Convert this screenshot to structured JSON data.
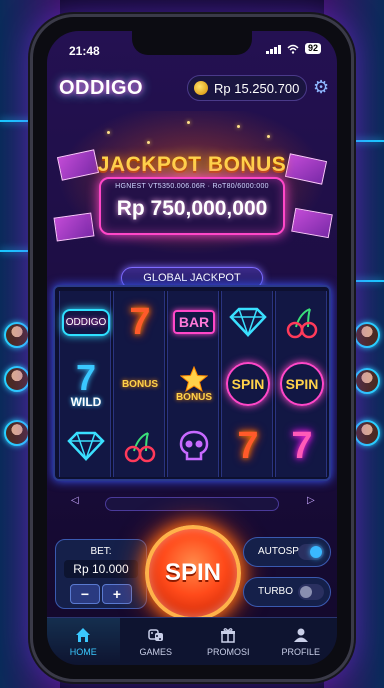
{
  "status_bar": {
    "time": "21:48",
    "battery": "92"
  },
  "header": {
    "logo": "ODDIGO",
    "balance": "Rp 15.250.700"
  },
  "jackpot": {
    "title": "JACKPOT BONUS",
    "subtitle": "HGNEST VT5350.006.06R · RoT80/6000:000",
    "amount": "Rp 750,000,000"
  },
  "global_jackpot_label": "GLOBAL JACKPOT",
  "reels": [
    [
      {
        "type": "oddigo",
        "label": "ODDIGO"
      },
      {
        "type": "wild",
        "label": "WILD",
        "glyph": "7"
      },
      {
        "type": "diamond",
        "icon": "diamond-icon"
      }
    ],
    [
      {
        "type": "seven",
        "glyph": "7"
      },
      {
        "type": "bonus",
        "label": "BONUS"
      },
      {
        "type": "cherry",
        "icon": "cherry-icon"
      }
    ],
    [
      {
        "type": "bar",
        "label": "BAR"
      },
      {
        "type": "star-bonus",
        "label": "BONUS",
        "icon": "star-icon"
      },
      {
        "type": "skull",
        "icon": "skull-icon"
      }
    ],
    [
      {
        "type": "diamond",
        "icon": "diamond-icon"
      },
      {
        "type": "spin",
        "label": "SPIN"
      },
      {
        "type": "seven",
        "glyph": "7"
      }
    ],
    [
      {
        "type": "cherry",
        "icon": "cherry-icon"
      },
      {
        "type": "spin",
        "label": "SPIN"
      },
      {
        "type": "seven-pink",
        "glyph": "7"
      }
    ]
  ],
  "controls": {
    "bet_label": "BET:",
    "bet_value": "Rp 10.000",
    "minus": "−",
    "plus": "+",
    "spin": "SPIN",
    "autospin_label": "AUTOSPIN",
    "autospin_on": true,
    "turbo_label": "TURBO",
    "turbo_on": false
  },
  "nav": [
    {
      "label": "HOME",
      "icon": "home-icon",
      "active": true
    },
    {
      "label": "GAMES",
      "icon": "dice-icon",
      "active": false
    },
    {
      "label": "PROMOSI",
      "icon": "gift-icon",
      "active": false
    },
    {
      "label": "PROFILE",
      "icon": "user-icon",
      "active": false
    }
  ],
  "colors": {
    "accent_cyan": "#3ac8ff",
    "accent_pink": "#ff47c8",
    "gold": "#ffd24a",
    "spin_orange": "#ff4a1a"
  }
}
